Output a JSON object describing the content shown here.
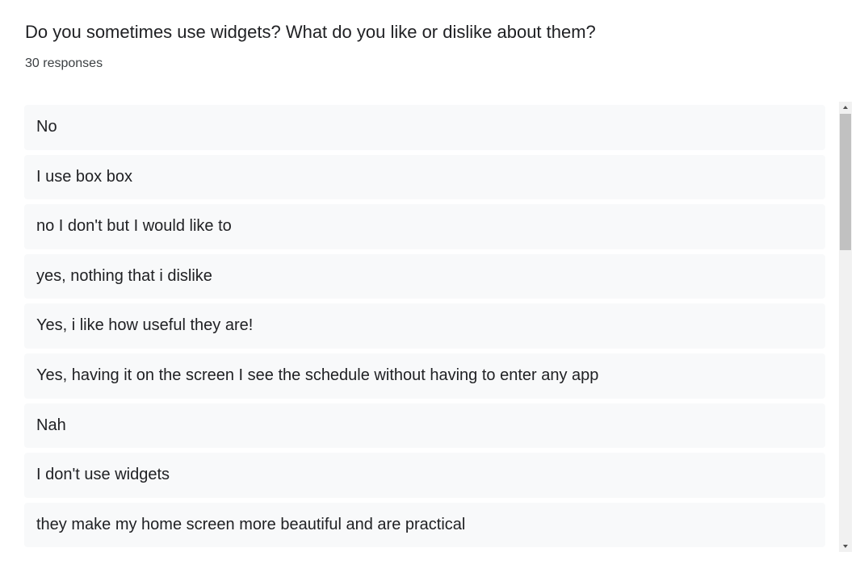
{
  "question": {
    "title": "Do you sometimes use widgets? What do you like or dislike about them?",
    "response_count": "30 responses"
  },
  "responses": [
    "No",
    "I use box box",
    "no I don't but I would like to",
    "yes, nothing that i dislike",
    "Yes, i like how useful they are!",
    "Yes, having it on the screen I see the schedule without having to enter any app",
    "Nah",
    "I don't use widgets",
    "they make my home screen more beautiful and are practical"
  ],
  "scrollbar": {
    "scroll_position_fraction": 0.0,
    "visible_fraction": 0.31
  },
  "colors": {
    "response_background": "#f8f9fa",
    "text": "#202124",
    "scroll_thumb": "#c1c1c1",
    "scroll_track": "#f1f1f1"
  },
  "icons": [
    "scroll-up-arrow-icon",
    "scroll-down-arrow-icon"
  ]
}
